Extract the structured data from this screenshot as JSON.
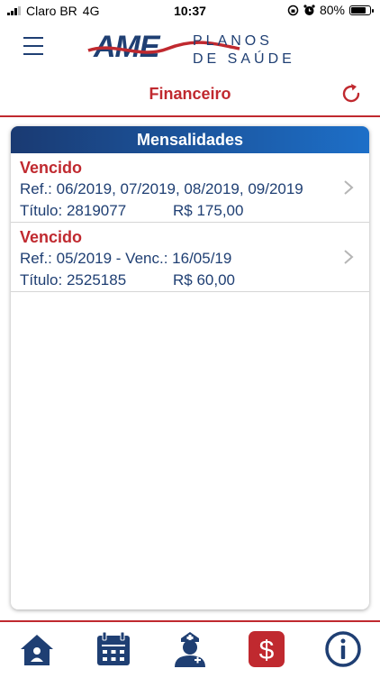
{
  "status_bar": {
    "carrier": "Claro BR",
    "network": "4G",
    "time": "10:37",
    "battery": "80%",
    "battery_level": 0.8
  },
  "header": {
    "logo_brand": "AME",
    "logo_line1": "PLANOS",
    "logo_line2": "DE SAÚDE",
    "title": "Financeiro"
  },
  "card": {
    "title": "Mensalidades",
    "items": [
      {
        "status": "Vencido",
        "ref": "Ref.: 06/2019, 07/2019, 08/2019, 09/2019",
        "titulo": "Título: 2819077",
        "valor": "R$ 175,00"
      },
      {
        "status": "Vencido",
        "ref": "Ref.: 05/2019 - Venc.: 16/05/19",
        "titulo": "Título: 2525185",
        "valor": "R$ 60,00"
      }
    ]
  },
  "colors": {
    "brand_red": "#c0292f",
    "brand_navy": "#1f3f73",
    "header_gradient_start": "#1a3a72",
    "header_gradient_end": "#1d6fc8"
  },
  "nav": [
    {
      "icon": "home-icon"
    },
    {
      "icon": "calendar-icon"
    },
    {
      "icon": "doctor-icon"
    },
    {
      "icon": "dollar-icon",
      "active": true
    },
    {
      "icon": "info-icon"
    }
  ]
}
